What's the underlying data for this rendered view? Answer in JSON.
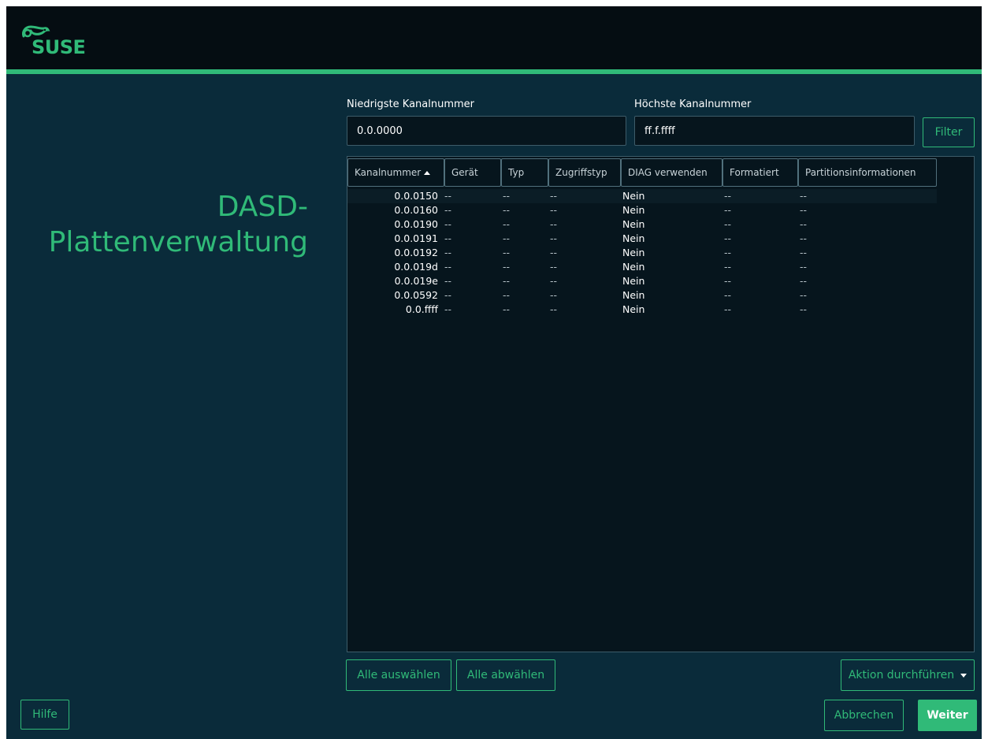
{
  "brand": {
    "name": "SUSE",
    "green": "#30ba78",
    "bg": "#0a2b3a",
    "topbar_bg": "#050d12"
  },
  "page_title_lines": [
    "DASD-",
    "Plattenverwaltung"
  ],
  "filters": {
    "min_label": "Niedrigste Kanalnummer",
    "min_value": "0.0.0000",
    "max_label": "Höchste Kanalnummer",
    "max_value": "ff.f.ffff",
    "filter_button": "Filter"
  },
  "table": {
    "columns": [
      "Kanalnummer",
      "Gerät",
      "Typ",
      "Zugriffstyp",
      "DIAG verwenden",
      "Formatiert",
      "Partitionsinformationen"
    ],
    "sort_icon": "sort-ascending-icon",
    "rows": [
      [
        "0.0.0150",
        "--",
        "--",
        "--",
        "Nein",
        "--",
        "--"
      ],
      [
        "0.0.0160",
        "--",
        "--",
        "--",
        "Nein",
        "--",
        "--"
      ],
      [
        "0.0.0190",
        "--",
        "--",
        "--",
        "Nein",
        "--",
        "--"
      ],
      [
        "0.0.0191",
        "--",
        "--",
        "--",
        "Nein",
        "--",
        "--"
      ],
      [
        "0.0.0192",
        "--",
        "--",
        "--",
        "Nein",
        "--",
        "--"
      ],
      [
        "0.0.019d",
        "--",
        "--",
        "--",
        "Nein",
        "--",
        "--"
      ],
      [
        "0.0.019e",
        "--",
        "--",
        "--",
        "Nein",
        "--",
        "--"
      ],
      [
        "0.0.0592",
        "--",
        "--",
        "--",
        "Nein",
        "--",
        "--"
      ],
      [
        "0.0.ffff",
        "--",
        "--",
        "--",
        "Nein",
        "--",
        "--"
      ]
    ]
  },
  "actions": {
    "select_all": "Alle auswählen",
    "deselect_all": "Alle abwählen",
    "perform_action": "Aktion durchführen"
  },
  "footer": {
    "help": "Hilfe",
    "cancel": "Abbrechen",
    "next": "Weiter"
  }
}
